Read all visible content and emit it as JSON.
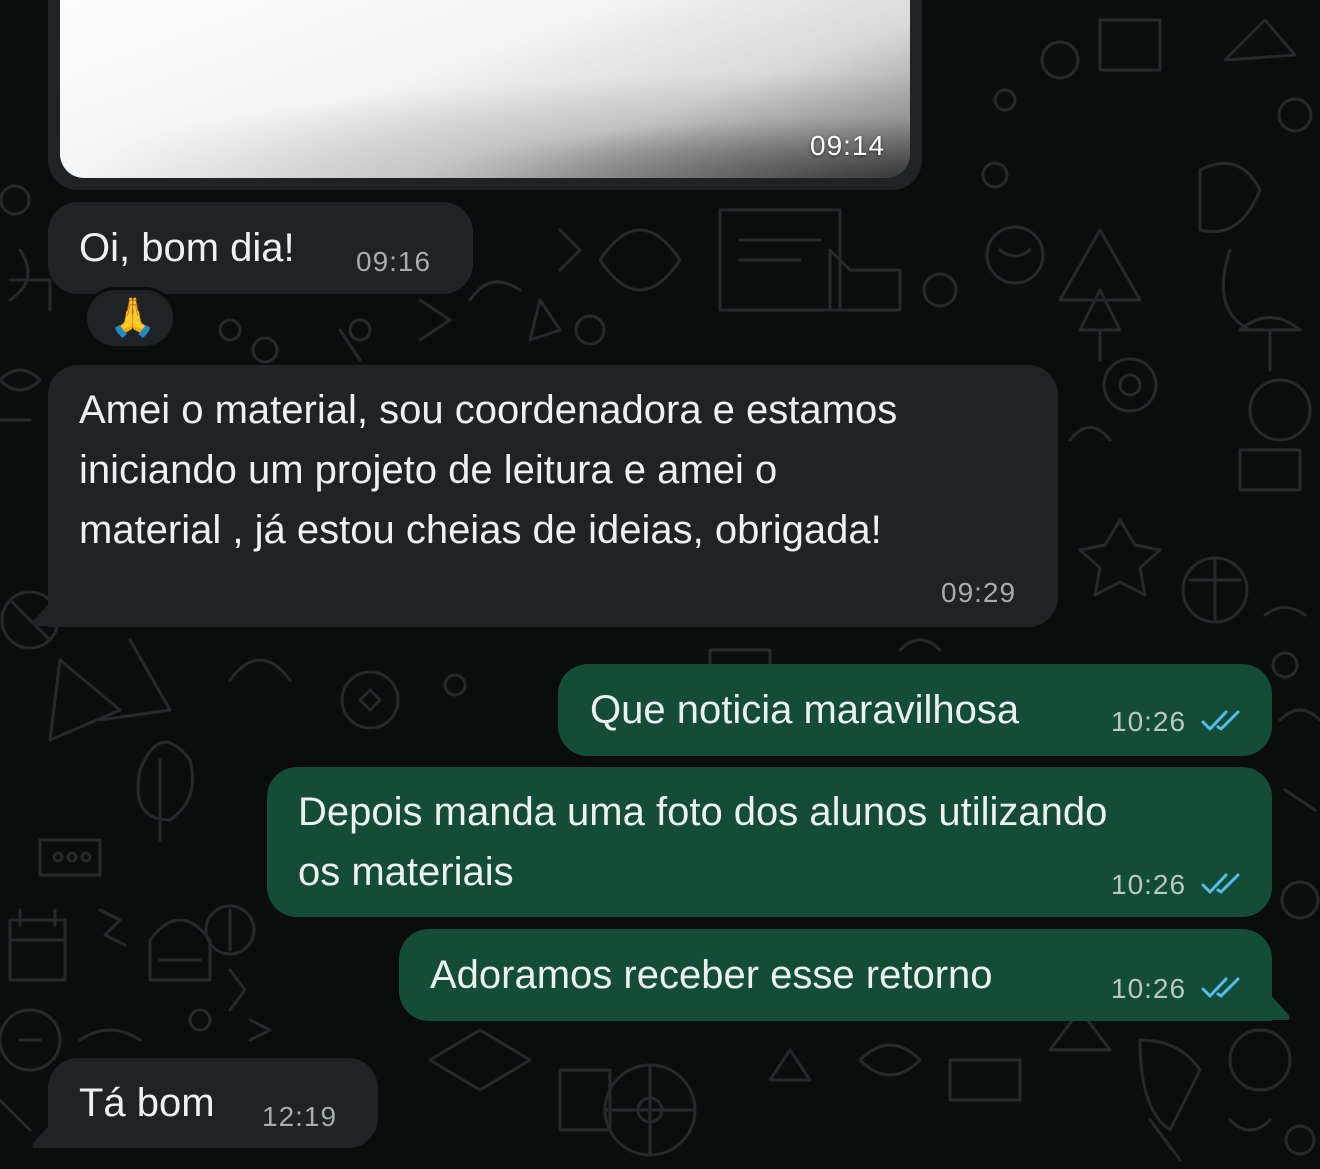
{
  "chat": {
    "image_message": {
      "time": "09:14"
    },
    "messages": [
      {
        "id": "m1",
        "direction": "incoming",
        "text": "Oi, bom dia!",
        "time": "09:16"
      },
      {
        "id": "m1_reaction",
        "emoji": "🙏"
      },
      {
        "id": "m2",
        "direction": "incoming",
        "text": "Amei o material, sou coordenadora e estamos\niniciando um projeto de leitura e amei  o\nmaterial , já estou cheias de ideias, obrigada!",
        "time": "09:29"
      },
      {
        "id": "m3",
        "direction": "outgoing",
        "text": "Que noticia maravilhosa",
        "time": "10:26",
        "status": "read"
      },
      {
        "id": "m4",
        "direction": "outgoing",
        "text": "Depois manda uma foto dos alunos utilizando\nos materiais",
        "time": "10:26",
        "status": "read"
      },
      {
        "id": "m5",
        "direction": "outgoing",
        "text": "Adoramos receber esse retorno",
        "time": "10:26",
        "status": "read"
      },
      {
        "id": "m6",
        "direction": "incoming",
        "text": "Tá bom",
        "time": "12:19"
      }
    ]
  },
  "colors": {
    "background": "#0b0c0c",
    "incoming_bubble": "#1f2325",
    "outgoing_bubble": "#134d37",
    "read_ticks": "#53bdeb"
  },
  "icons": {
    "read_receipt": "double-check-icon",
    "wallpaper": "doodle-pattern"
  }
}
